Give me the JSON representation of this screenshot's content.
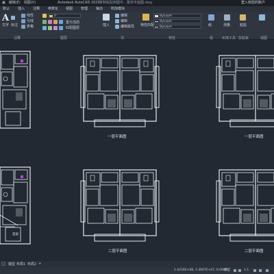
{
  "app": {
    "menu": [
      "▣",
      "编辑(E)",
      "视图(V)"
    ],
    "title": "Autodesk AutoCAD 2020",
    "title2": "复制粘贴到图中…整体平面图.dwg",
    "signin": "登入到您的账户"
  },
  "tabs": [
    "默认",
    "插入",
    "注释",
    "参数化",
    "视图",
    "管理",
    "输出",
    "附加模块"
  ],
  "ribbon": {
    "big_text_icon": "A",
    "text_label": "文字",
    "dim_label": "标注",
    "annot_label": "注释",
    "layers_label": "图层",
    "block_label": "块",
    "props_label": "特性",
    "groups_label": "组",
    "util_label": "实用工具",
    "clip_label": "剪贴板",
    "view_label": "视图",
    "insert_label": "插入",
    "edit_label": "编辑",
    "edit_attr_label": "编辑属性",
    "match_label": "特性匹配",
    "layer_match": "匹配图层",
    "layer_state": "置为当前",
    "bylayer_color": "ByLayer",
    "bylayer_ltype": "ByLayer",
    "bylayer_lweight": "ByLayer",
    "measure_label": "测量",
    "paste_label": "粘贴",
    "group_label": "组",
    "layer_current": "0",
    "line_label": "线性",
    "leader_label": "引线",
    "table_label": "表格"
  },
  "plans": {
    "label_first": "一层平面图",
    "label_second": "二层平面图",
    "label_row2_second_left": "二层平面图",
    "label_row2_second_right": "二层平面图",
    "label_row2_small": "首层"
  },
  "layout_tabs": [
    "模型",
    "布局1",
    "布局2",
    "+"
  ],
  "status": {
    "coords": "1.4216E+08, 3.3607E+07, 0.0000",
    "mode": "模型",
    "zoom": "1:1"
  },
  "colors": {
    "background": "#222933",
    "linework": "#e9edf1",
    "accent_magenta": "#c43cf0",
    "ribbon": "#2f3640"
  }
}
